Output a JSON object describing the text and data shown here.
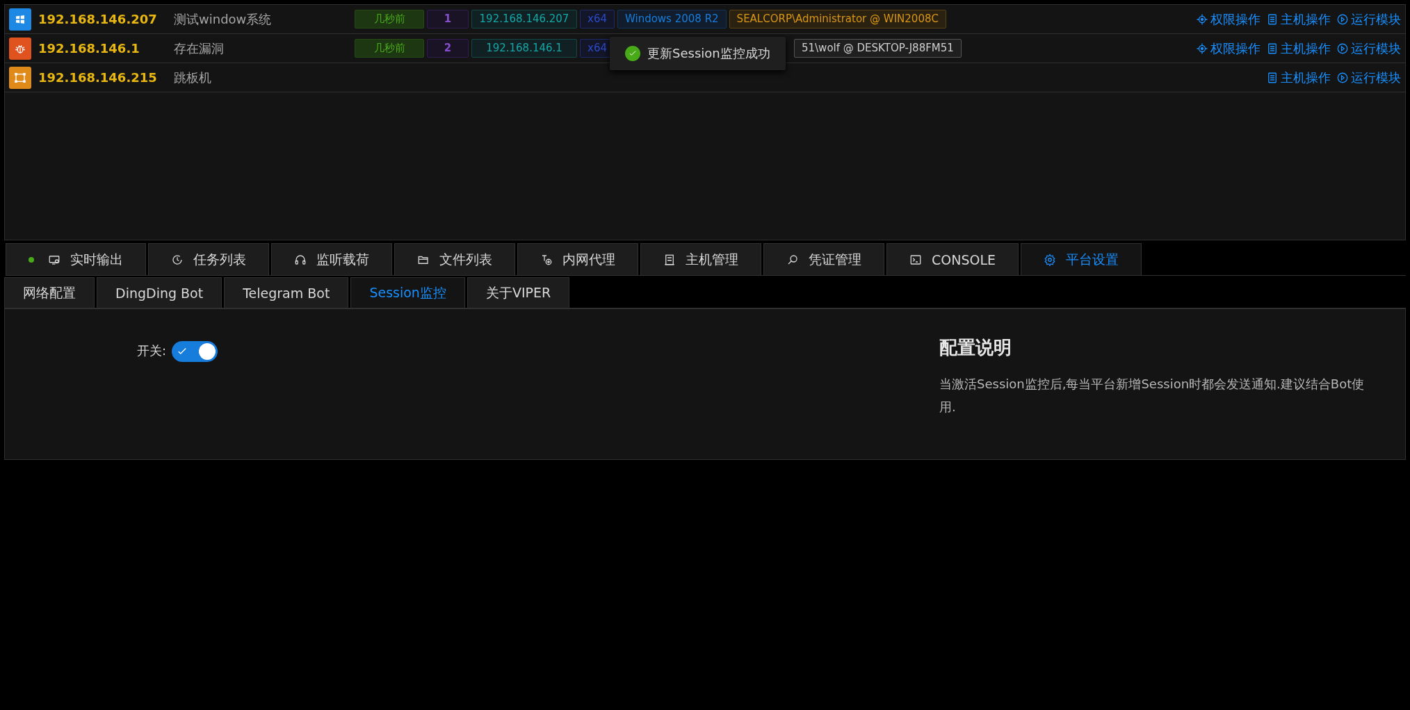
{
  "sessions": [
    {
      "kind": "windows",
      "color": "#1e88e5",
      "ip": "192.168.146.207",
      "name": "测试window系统",
      "tags": [
        {
          "kind": "time",
          "text": "几秒前"
        },
        {
          "kind": "count",
          "text": "1"
        },
        {
          "kind": "ip",
          "text": "192.168.146.207"
        },
        {
          "kind": "arch",
          "text": "x64"
        },
        {
          "kind": "os",
          "text": "Windows 2008 R2"
        },
        {
          "kind": "admin",
          "text": "SEALCORP\\Administrator @ WIN2008C"
        }
      ],
      "actions": [
        {
          "kind": "privilege",
          "label": "权限操作"
        },
        {
          "kind": "host",
          "label": "主机操作"
        },
        {
          "kind": "module",
          "label": "运行模块"
        }
      ]
    },
    {
      "kind": "vuln",
      "color": "#e0531f",
      "ip": "192.168.146.1",
      "name": "存在漏洞",
      "tags": [
        {
          "kind": "time",
          "text": "几秒前"
        },
        {
          "kind": "count",
          "text": "2"
        },
        {
          "kind": "ip",
          "text": "192.168.146.1"
        },
        {
          "kind": "arch",
          "text": "x64"
        },
        {
          "kind": "user",
          "text": "51\\wolf @ DESKTOP-J88FM51"
        }
      ],
      "actions": [
        {
          "kind": "privilege",
          "label": "权限操作"
        },
        {
          "kind": "host",
          "label": "主机操作"
        },
        {
          "kind": "module",
          "label": "运行模块"
        }
      ]
    },
    {
      "kind": "pivot",
      "color": "#e08a1a",
      "ip": "192.168.146.215",
      "name": "跳板机",
      "actions": [
        {
          "kind": "host",
          "label": "主机操作"
        },
        {
          "kind": "module",
          "label": "运行模块"
        }
      ]
    }
  ],
  "toast": {
    "text": "更新Session监控成功"
  },
  "tabs": [
    {
      "label": "实时输出",
      "selected": false,
      "live": true
    },
    {
      "label": "任务列表",
      "selected": false,
      "live": false
    },
    {
      "label": "监听载荷",
      "selected": false,
      "live": false
    },
    {
      "label": "文件列表",
      "selected": false,
      "live": false
    },
    {
      "label": "内网代理",
      "selected": false,
      "live": false
    },
    {
      "label": "主机管理",
      "selected": false,
      "live": false
    },
    {
      "label": "凭证管理",
      "selected": false,
      "live": false
    },
    {
      "label": "CONSOLE",
      "selected": false,
      "live": false
    },
    {
      "label": "平台设置",
      "selected": true,
      "live": false
    }
  ],
  "subtabs": [
    {
      "label": "网络配置",
      "selected": false
    },
    {
      "label": "DingDing Bot",
      "selected": false
    },
    {
      "label": "Telegram Bot",
      "selected": false
    },
    {
      "label": "Session监控",
      "selected": true
    },
    {
      "label": "关于VIPER",
      "selected": false
    }
  ],
  "settings": {
    "switch_label": "开关:",
    "switch_on": true,
    "help_title": "配置说明",
    "help_text": "当激活Session监控后,每当平台新增Session时都会发送通知.建议结合Bot使用."
  }
}
